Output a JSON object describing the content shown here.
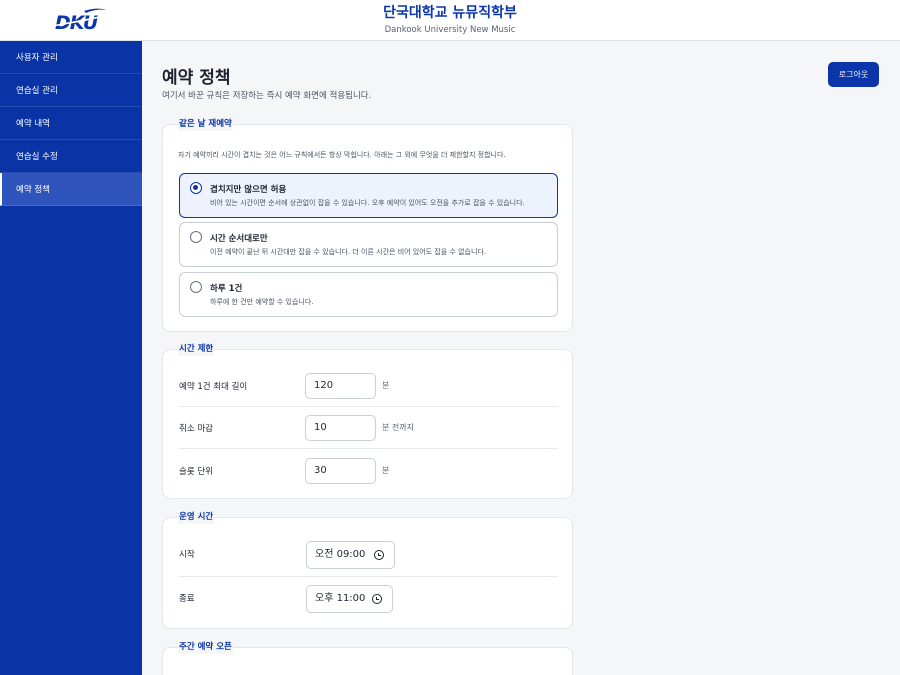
{
  "header": {
    "logo_text": "DKU",
    "title": "단국대학교 뉴뮤직학부",
    "subtitle": "Dankook University New Music"
  },
  "sidebar": {
    "items": [
      {
        "label": "사용자 관리"
      },
      {
        "label": "연습실 관리"
      },
      {
        "label": "예약 내역"
      },
      {
        "label": "연습실 수정"
      },
      {
        "label": "예약 정책"
      }
    ],
    "active_index": 4
  },
  "main": {
    "title": "예약 정책",
    "description": "여기서 바꾼 규칙은 저장하는 즉시 예약 화면에 적용됩니다.",
    "logout_label": "로그아웃"
  },
  "same_day": {
    "title": "같은 날 재예약",
    "description": "자기 예약끼리 시간이 겹치는 것은 어느 규칙에서든 항상 막힙니다. 아래는 그 외에 무엇을 더 제한할지 정합니다.",
    "options": [
      {
        "label": "겹치지만 않으면 허용",
        "desc": "비어 있는 시간이면 순서에 상관없이 잡을 수 있습니다. 오후 예약이 있어도 오전을 추가로 잡을 수 있습니다.",
        "selected": true
      },
      {
        "label": "시간 순서대로만",
        "desc": "이전 예약이 끝난 뒤 시간대만 잡을 수 있습니다. 더 이른 시간은 비어 있어도 잡을 수 없습니다.",
        "selected": false
      },
      {
        "label": "하루 1건",
        "desc": "하루에 한 건만 예약할 수 있습니다.",
        "selected": false
      }
    ]
  },
  "time_limits": {
    "title": "시간 제한",
    "rows": [
      {
        "label": "예약 1건 최대 길이",
        "value": "120",
        "unit": "분"
      },
      {
        "label": "취소 마감",
        "value": "10",
        "unit": "분 전까지"
      },
      {
        "label": "슬롯 단위",
        "value": "30",
        "unit": "분"
      }
    ]
  },
  "operating_hours": {
    "title": "운영 시간",
    "rows": [
      {
        "label": "시작",
        "value": "오전 09:00"
      },
      {
        "label": "종료",
        "value": "오후 11:00"
      }
    ]
  },
  "weekly_open": {
    "title": "주간 예약 오픈"
  },
  "colors": {
    "brand": "#0b35a8",
    "sidebar": "#0a34a6",
    "background": "#f5f6f8"
  }
}
